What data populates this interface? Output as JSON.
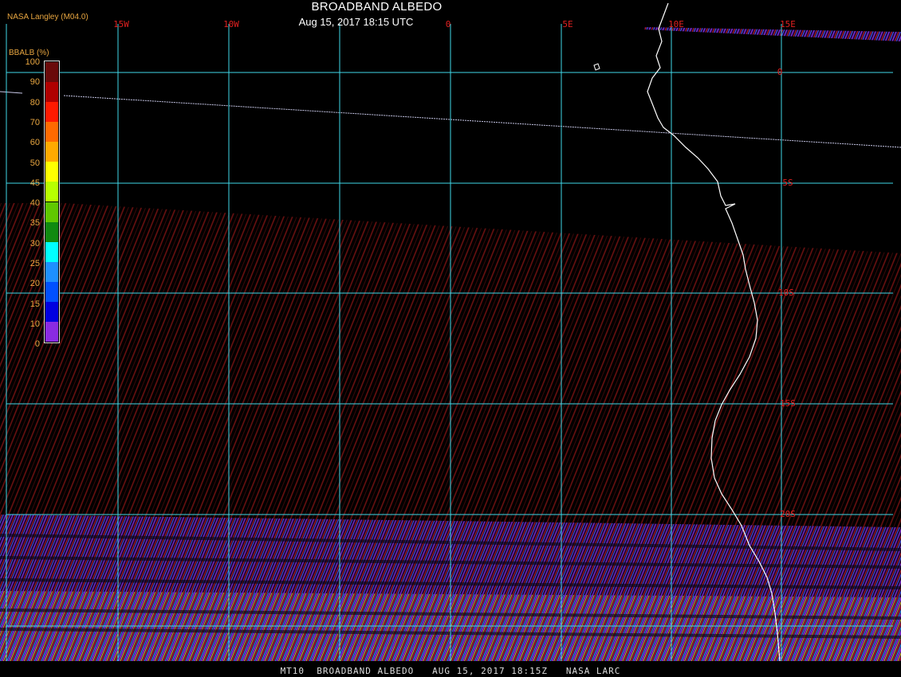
{
  "header": {
    "title": "BROADBAND ALBEDO",
    "subtitle": "Aug 15, 2017 18:15 UTC",
    "credit": "NASA Langley (M04.0)"
  },
  "footer": {
    "text": "MT10  BROADBAND ALBEDO   AUG 15, 2017 18:15Z   NASA LARC"
  },
  "colorbar": {
    "label": "BBALB (%)",
    "ticks": [
      "100",
      "90",
      "80",
      "70",
      "60",
      "50",
      "45",
      "40",
      "35",
      "30",
      "25",
      "20",
      "15",
      "10",
      "0"
    ],
    "colors": [
      "#6a0a0a",
      "#b00000",
      "#ff1a00",
      "#ff6a00",
      "#ffaa00",
      "#ffff00",
      "#b8ff00",
      "#60c800",
      "#108a10",
      "#00ffff",
      "#1e90ff",
      "#0050ff",
      "#0000e0",
      "#8a2be2"
    ]
  },
  "map": {
    "longitude_labels": [
      "15W",
      "10W",
      "0",
      "5E",
      "10E",
      "15E"
    ],
    "latitude_labels": [
      "0",
      "5S",
      "10S",
      "15S",
      "20S"
    ],
    "grid_color": "#40d8e8",
    "coast_color": "#ffffff",
    "label_color": "#e02020"
  }
}
